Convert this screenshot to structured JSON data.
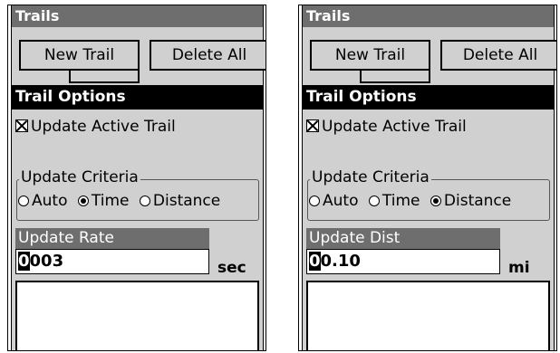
{
  "left": {
    "header": "Trails",
    "new_trail": "New Trail",
    "delete_all": "Delete All",
    "options_title": "Trail Options",
    "update_active": "Update Active Trail",
    "criteria_label": "Update Criteria",
    "radio_auto": "Auto",
    "radio_time": "Time",
    "radio_distance": "Distance",
    "selected": "Time",
    "field_label": "Update Rate",
    "field_cursor": "0",
    "field_rest": "003",
    "unit": "sec"
  },
  "right": {
    "header": "Trails",
    "new_trail": "New Trail",
    "delete_all": "Delete All",
    "options_title": "Trail Options",
    "update_active": "Update Active Trail",
    "criteria_label": "Update Criteria",
    "radio_auto": "Auto",
    "radio_time": "Time",
    "radio_distance": "Distance",
    "selected": "Distance",
    "field_label": "Update Dist",
    "field_cursor": "0",
    "field_rest": "0.10",
    "unit": "mi"
  },
  "colors": {
    "header_bg": "#6e6e6e",
    "panel_bg": "#d0d0d0",
    "title_bar_bg": "#000000"
  }
}
